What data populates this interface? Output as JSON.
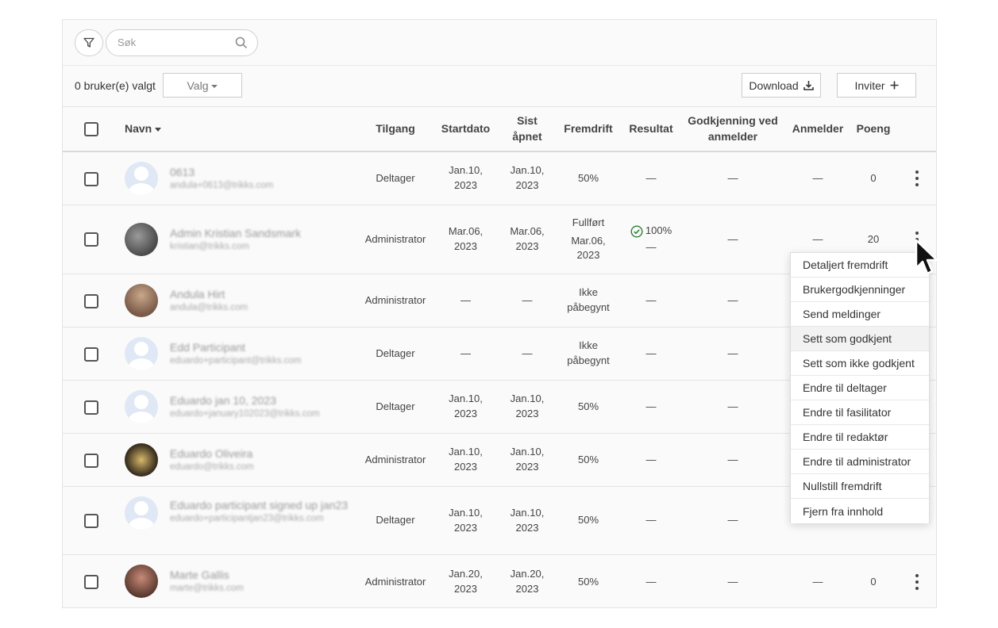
{
  "search": {
    "placeholder": "Søk"
  },
  "actions": {
    "selected_count": "0 bruker(e) valgt",
    "valg_label": "Valg",
    "download_label": "Download",
    "invite_label": "Inviter"
  },
  "columns": {
    "name": "Navn",
    "access": "Tilgang",
    "start": "Startdato",
    "last_opened": "Sist åpnet",
    "progress": "Fremdrift",
    "result": "Resultat",
    "approval": "Godkjenning ved anmelder",
    "reviewer": "Anmelder",
    "points": "Poeng"
  },
  "rows": [
    {
      "name": "0613",
      "email": "andula+0613@trikks.com",
      "access": "Deltager",
      "start": "Jan.10, 2023",
      "last": "Jan.10, 2023",
      "progress": "50%",
      "result": "—",
      "approval": "—",
      "reviewer": "—",
      "points": "0"
    },
    {
      "name": "Admin Kristian Sandsmark",
      "email": "kristian@trikks.com",
      "access": "Administrator",
      "start": "Mar.06, 2023",
      "last": "Mar.06, 2023",
      "progress_status": "Fullført",
      "progress_date": "Mar.06, 2023",
      "result_pct": "100%",
      "result_sub": "—",
      "approval": "—",
      "reviewer": "—",
      "points": "20"
    },
    {
      "name": "Andula Hirt",
      "email": "andula@trikks.com",
      "access": "Administrator",
      "start": "—",
      "last": "—",
      "progress": "Ikke påbegynt",
      "result": "—",
      "approval": "—"
    },
    {
      "name": "Edd Participant",
      "email": "eduardo+participant@trikks.com",
      "access": "Deltager",
      "start": "—",
      "last": "—",
      "progress": "Ikke påbegynt",
      "result": "—",
      "approval": "—"
    },
    {
      "name": "Eduardo jan 10, 2023",
      "email": "eduardo+january102023@trikks.com",
      "access": "Deltager",
      "start": "Jan.10, 2023",
      "last": "Jan.10, 2023",
      "progress": "50%",
      "result": "—",
      "approval": "—"
    },
    {
      "name": "Eduardo Oliveira",
      "email": "eduardo@trikks.com",
      "access": "Administrator",
      "start": "Jan.10, 2023",
      "last": "Jan.10, 2023",
      "progress": "50%",
      "result": "—",
      "approval": "—"
    },
    {
      "name": "Eduardo participant signed up jan23",
      "email": "eduardo+participantjan23@trikks.com",
      "access": "Deltager",
      "start": "Jan.10, 2023",
      "last": "Jan.10, 2023",
      "progress": "50%",
      "result": "—",
      "approval": "—"
    },
    {
      "name": "Marte Gallis",
      "email": "marte@trikks.com",
      "access": "Administrator",
      "start": "Jan.20, 2023",
      "last": "Jan.20, 2023",
      "progress": "50%",
      "result": "—",
      "approval": "—",
      "reviewer": "—",
      "points": "0"
    }
  ],
  "menu": {
    "items": [
      "Detaljert fremdrift",
      "Brukergodkjenninger",
      "Send meldinger",
      "Sett som godkjent",
      "Sett som ikke godkjent",
      "Endre til deltager",
      "Endre til fasilitator",
      "Endre til redaktør",
      "Endre til administrator",
      "Nullstill fremdrift",
      "Fjern fra innhold"
    ],
    "hovered": "Sett som godkjent"
  },
  "colors": {
    "success": "#2e7d32",
    "text": "#444444",
    "border": "#e4e4e4"
  }
}
